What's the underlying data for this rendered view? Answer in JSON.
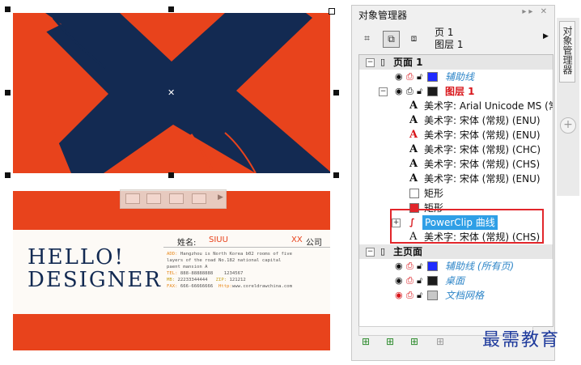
{
  "colors": {
    "card_orange": "#e8431c",
    "card_navy": "#132a52",
    "selection_blue": "#2f9fe6",
    "highlight_red": "#e2262b",
    "guide_blue": "#2f86c8"
  },
  "card_back": {
    "headline_line1": "HELLO!",
    "headline_line2": "DESIGNER",
    "name_label": "姓名:",
    "name_value": "SIUU",
    "company_mark": "XX",
    "company_label": "公司",
    "addr_key": "ADD:",
    "addr_line1": "Hangzhou is North Korea b02 rooms of five",
    "addr_line2": "layers of the road No.182 national capital",
    "addr_line3": "paent mansion A",
    "tel_key": "TEL:",
    "tel_value": "888-88888888",
    "qq_value": "1234567",
    "mb_key": "MB:",
    "mb_value": "22233344444",
    "zip_key": "ZIP:",
    "zip_value": "121212",
    "fax_key": "FAX:",
    "fax_value": "666-66666666",
    "http_key": "Http:",
    "http_value": "www.coreldrawchina.com"
  },
  "panel": {
    "title": "对象管理器",
    "title_icons": "▸▸ ✕",
    "page_label": "页 1",
    "layer_label": "图层 1",
    "side_tab": "对象管理器",
    "toolbar_icons": [
      "object-properties-icon",
      "show-layers-icon",
      "layer-manager-icon"
    ],
    "tree": [
      {
        "kind": "page",
        "label": "页面 1"
      },
      {
        "kind": "layer",
        "label": "辅助线",
        "style": "guide",
        "swatch": "#1f2bff"
      },
      {
        "kind": "layer",
        "label": "图层 1",
        "style": "active",
        "swatch": "#1c1c1c"
      },
      {
        "kind": "text",
        "label": "美术字: Arial Unicode MS (常规"
      },
      {
        "kind": "text",
        "label": "美术字: 宋体 (常规) (ENU)"
      },
      {
        "kind": "text",
        "label": "美术字: 宋体 (常规) (ENU)",
        "red": true
      },
      {
        "kind": "text",
        "label": "美术字: 宋体 (常规) (CHC)"
      },
      {
        "kind": "text",
        "label": "美术字: 宋体 (常规) (CHS)"
      },
      {
        "kind": "text",
        "label": "美术字: 宋体 (常规) (ENU)"
      },
      {
        "kind": "rect",
        "label": "矩形",
        "fill": "#ffffff"
      },
      {
        "kind": "rect",
        "label": "矩形",
        "fill": "#e2262b"
      },
      {
        "kind": "powerclip",
        "label": "PowerClip 曲线"
      },
      {
        "kind": "text",
        "label": "美术字: 宋体 (常规) (CHS)",
        "outline": true
      },
      {
        "kind": "page",
        "label": "主页面"
      },
      {
        "kind": "layer",
        "label": "辅助线 (所有页)",
        "style": "guide",
        "swatch": "#1f2bff"
      },
      {
        "kind": "layer",
        "label": "桌面",
        "style": "guide",
        "swatch": "#1c1c1c"
      },
      {
        "kind": "layer",
        "label": "文档网格",
        "style": "guide",
        "swatch": "#c8c8c8"
      }
    ],
    "footer_icons": [
      "new-layer-icon",
      "new-master-layer-icon",
      "new-master-layer-odd-icon",
      "delete-icon"
    ]
  },
  "watermark": "最需教育"
}
